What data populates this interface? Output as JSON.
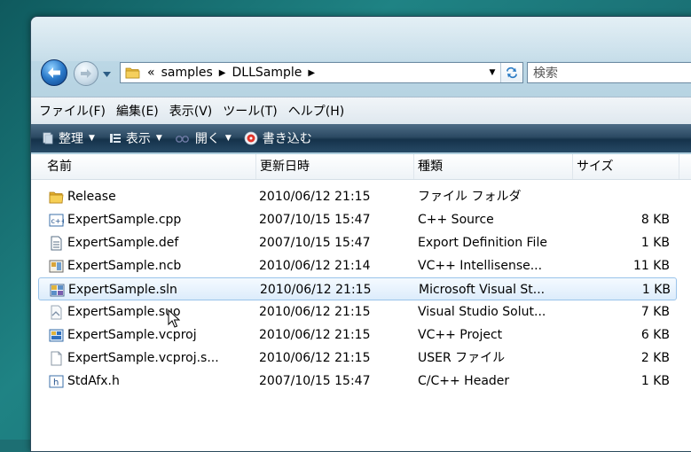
{
  "address": {
    "overflow": "«",
    "crumbs": [
      "samples",
      "DLLSample"
    ],
    "search_placeholder": "検索"
  },
  "menu": [
    "ファイル(F)",
    "編集(E)",
    "表示(V)",
    "ツール(T)",
    "ヘルプ(H)"
  ],
  "commands": {
    "organize": "整理",
    "views": "表示",
    "open": "開く",
    "burn": "書き込む"
  },
  "columns": {
    "name": "名前",
    "date": "更新日時",
    "type": "種類",
    "size": "サイズ"
  },
  "files": [
    {
      "name": "Release",
      "date": "2010/06/12 21:15",
      "type": "ファイル フォルダ",
      "size": "",
      "icon": "folder-icon"
    },
    {
      "name": "ExpertSample.cpp",
      "date": "2007/10/15 15:47",
      "type": "C++ Source",
      "size": "8 KB",
      "icon": "cpp-file-icon"
    },
    {
      "name": "ExpertSample.def",
      "date": "2007/10/15 15:47",
      "type": "Export Definition File",
      "size": "1 KB",
      "icon": "text-file-icon"
    },
    {
      "name": "ExpertSample.ncb",
      "date": "2010/06/12 21:14",
      "type": "VC++ Intellisense...",
      "size": "11 KB",
      "icon": "ncb-file-icon"
    },
    {
      "name": "ExpertSample.sln",
      "date": "2010/06/12 21:15",
      "type": "Microsoft Visual St...",
      "size": "1 KB",
      "icon": "sln-file-icon",
      "selected": true
    },
    {
      "name": "ExpertSample.suo",
      "date": "2010/06/12 21:15",
      "type": "Visual Studio Solut...",
      "size": "7 KB",
      "icon": "suo-file-icon"
    },
    {
      "name": "ExpertSample.vcproj",
      "date": "2010/06/12 21:15",
      "type": "VC++ Project",
      "size": "6 KB",
      "icon": "vcproj-file-icon"
    },
    {
      "name": "ExpertSample.vcproj.s...",
      "date": "2010/06/12 21:15",
      "type": "USER ファイル",
      "size": "2 KB",
      "icon": "blank-file-icon"
    },
    {
      "name": "StdAfx.h",
      "date": "2007/10/15 15:47",
      "type": "C/C++ Header",
      "size": "1 KB",
      "icon": "header-file-icon"
    }
  ]
}
